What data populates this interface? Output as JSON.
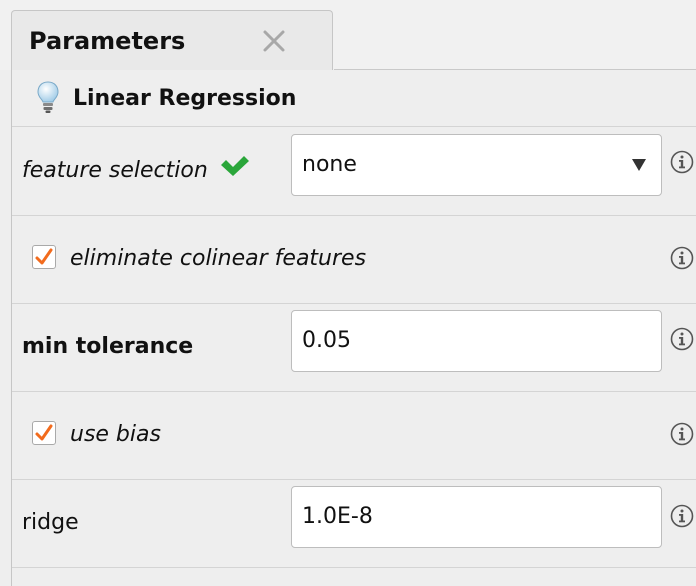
{
  "tab": {
    "title": "Parameters"
  },
  "panel": {
    "title": "Linear Regression"
  },
  "params": {
    "feature_selection": {
      "label": "feature selection",
      "value": "none"
    },
    "eliminate_colinear": {
      "label": "eliminate colinear features",
      "checked": true
    },
    "min_tolerance": {
      "label": "min tolerance",
      "value": "0.05"
    },
    "use_bias": {
      "label": "use bias",
      "checked": true
    },
    "ridge": {
      "label": "ridge",
      "value": "1.0E-8"
    }
  },
  "colors": {
    "accent_check": "#f26b1d",
    "ok_green": "#2aa63a"
  }
}
